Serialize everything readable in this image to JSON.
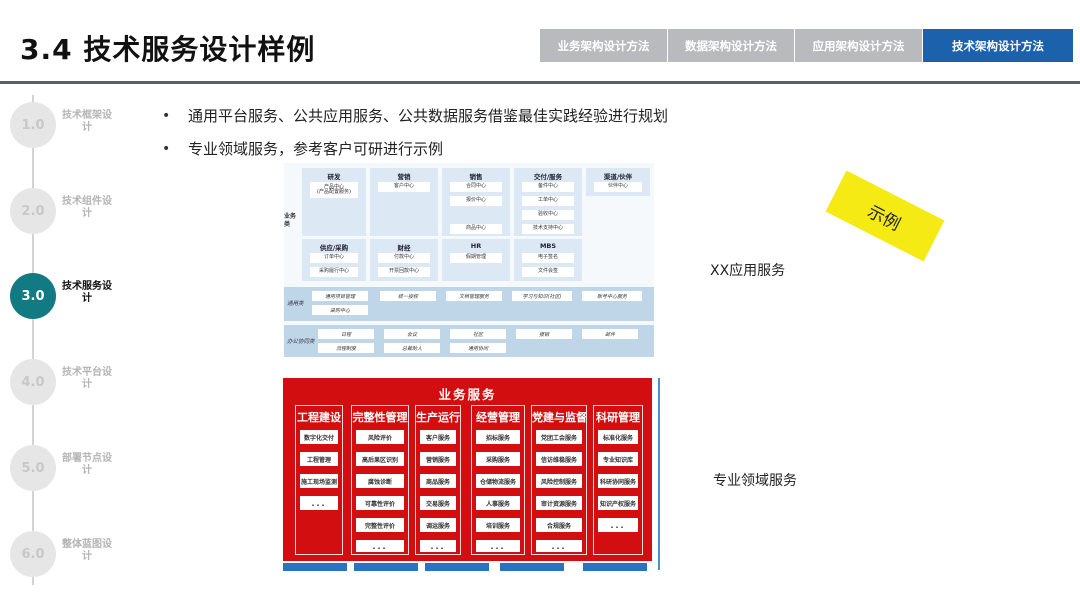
{
  "header": {
    "title": "3.4 技术服务设计样例",
    "tabs": [
      {
        "label": "业务架构设计方法",
        "active": false
      },
      {
        "label": "数据架构设计方法",
        "active": false
      },
      {
        "label": "应用架构设计方法",
        "active": false
      },
      {
        "label": "技术架构设计方法",
        "active": true
      }
    ]
  },
  "steps": [
    {
      "num": "1.0",
      "label": "技术框架设计",
      "active": false
    },
    {
      "num": "2.0",
      "label": "技术组件设计",
      "active": false
    },
    {
      "num": "3.0",
      "label": "技术服务设计",
      "active": true
    },
    {
      "num": "4.0",
      "label": "技术平台设计",
      "active": false
    },
    {
      "num": "5.0",
      "label": "部署节点设计",
      "active": false
    },
    {
      "num": "6.0",
      "label": "整体蓝图设计",
      "active": false
    }
  ],
  "bullets": [
    "通用平台服务、公共应用服务、公共数据服务借鉴最佳实践经验进行规划",
    "专业领域服务，参考客户可研进行示例"
  ],
  "app_diagram": {
    "side_label": "业务类",
    "cards": [
      {
        "title": "研发",
        "items": [
          "产品中心\n(产品配置服务)"
        ]
      },
      {
        "title": "营销",
        "items": [
          "客户中心"
        ]
      },
      {
        "title": "销售",
        "items": [
          "合同中心",
          "报价中心",
          "商品中心"
        ]
      },
      {
        "title": "交付/服务",
        "items": [
          "备件中心",
          "工单中心",
          "验收中心",
          "技术支持中心"
        ]
      },
      {
        "title": "渠道/伙伴",
        "items": [
          "伙伴中心"
        ]
      },
      {
        "title": "供应/采购",
        "items": [
          "订单中心",
          "采购履行中心"
        ]
      },
      {
        "title": "财经",
        "items": [
          "付款中心",
          "开票回款中心"
        ]
      },
      {
        "title": "HR",
        "items": [
          "假期管理"
        ]
      },
      {
        "title": "MBS",
        "items": [
          "电子签名",
          "文件会签"
        ]
      }
    ],
    "common_band": {
      "label": "通用类",
      "items": [
        "通用项目管理",
        "统一授权",
        "文档管理服务",
        "学习与知识(社区)",
        "账号中心服务",
        "采购中心"
      ]
    },
    "office_band": {
      "label": "办公协同类",
      "items": [
        "日程",
        "会议",
        "社区",
        "报销",
        "邮件",
        "流程制度",
        "总裁助人",
        "通用协同"
      ]
    }
  },
  "caption_app": "XX应用服务",
  "stamp": "示例",
  "biz": {
    "title": "业务服务",
    "columns": [
      {
        "title": "工程建设",
        "items": [
          "数字化交付",
          "工程管理",
          "施工现场监测",
          "..."
        ]
      },
      {
        "title": "完整性管理",
        "items": [
          "风险评价",
          "高后果区识别",
          "腐蚀诊断",
          "可靠性评价",
          "完整性评价",
          "..."
        ]
      },
      {
        "title": "生产运行",
        "items": [
          "客户服务",
          "营销服务",
          "商品服务",
          "交易服务",
          "调运服务",
          "..."
        ]
      },
      {
        "title": "经营管理",
        "items": [
          "招标服务",
          "采购服务",
          "仓储物流服务",
          "人事服务",
          "培训服务",
          "..."
        ]
      },
      {
        "title": "党建与监督",
        "items": [
          "党团工会服务",
          "信访维稳服务",
          "风险控制服务",
          "审计资源服务",
          "合规服务",
          "..."
        ]
      },
      {
        "title": "科研管理",
        "items": [
          "标准化服务",
          "专业知识库",
          "科研协同服务",
          "知识产权服务",
          "..."
        ]
      }
    ]
  },
  "caption_domain": "专业领域服务",
  "colors": {
    "accent": "#1b61ac",
    "active_step": "#127a83",
    "biz_red": "#d20e10",
    "stamp": "#f5ea14"
  }
}
